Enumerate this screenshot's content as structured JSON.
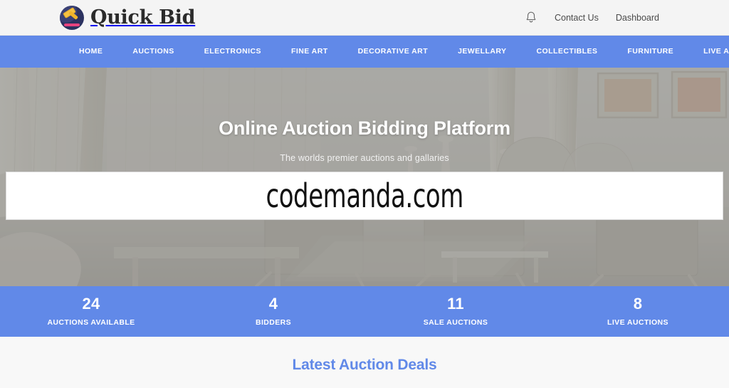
{
  "header": {
    "brand_name": "Quick Bid",
    "logo_icon": "gavel-logo-icon",
    "bell_icon": "bell-icon",
    "links": [
      {
        "label": "Contact Us",
        "name": "contact-us"
      },
      {
        "label": "Dashboard",
        "name": "dashboard"
      }
    ]
  },
  "nav": {
    "items": [
      {
        "label": "HOME",
        "name": "home"
      },
      {
        "label": "AUCTIONS",
        "name": "auctions"
      },
      {
        "label": "ELECTRONICS",
        "name": "electronics"
      },
      {
        "label": "FINE ART",
        "name": "fine-art"
      },
      {
        "label": "DECORATIVE ART",
        "name": "decorative-art"
      },
      {
        "label": "JEWELLARY",
        "name": "jewellary"
      },
      {
        "label": "COLLECTIBLES",
        "name": "collectibles"
      },
      {
        "label": "FURNITURE",
        "name": "furniture"
      },
      {
        "label": "LIVE AUCTIONS",
        "name": "live-auctions"
      }
    ]
  },
  "hero": {
    "title": "Online Auction Bidding Platform",
    "subtitle": "The worlds premier auctions and gallaries"
  },
  "overlay": {
    "text": "codemanda.com"
  },
  "stats": [
    {
      "value": "24",
      "label": "AUCTIONS AVAILABLE",
      "name": "auctions-available"
    },
    {
      "value": "4",
      "label": "BIDDERS",
      "name": "bidders"
    },
    {
      "value": "11",
      "label": "SALE AUCTIONS",
      "name": "sale-auctions"
    },
    {
      "value": "8",
      "label": "LIVE AUCTIONS",
      "name": "live-auctions"
    }
  ],
  "latest": {
    "title": "Latest Auction Deals"
  },
  "colors": {
    "accent_blue": "#6189e8",
    "header_bg": "#f4f4f4",
    "section_bg": "#f8f8f8",
    "brand_text": "#2b2b2b"
  }
}
